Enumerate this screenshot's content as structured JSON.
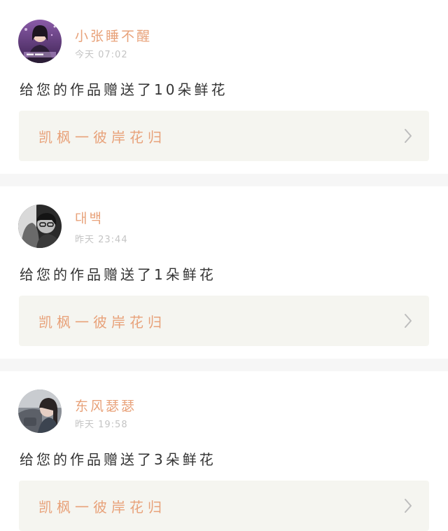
{
  "notifications": [
    {
      "username": "小张睡不醒",
      "time": "今天 07:02",
      "message": "给您的作品赠送了10朵鲜花",
      "work_title": "凯枫一彼岸花归",
      "avatar_icon": "user-avatar-purple-portrait"
    },
    {
      "username": "대백",
      "time": "昨天 23:44",
      "message": "给您的作品赠送了1朵鲜花",
      "work_title": "凯枫一彼岸花归",
      "avatar_icon": "user-avatar-grayscale-portrait"
    },
    {
      "username": "东风瑟瑟",
      "time": "昨天 19:58",
      "message": "给您的作品赠送了3朵鲜花",
      "work_title": "凯枫一彼岸花归",
      "avatar_icon": "user-avatar-car-portrait"
    }
  ],
  "colors": {
    "accent": "#e8a27a",
    "link_background": "#f5f5f0",
    "separator": "#f6f6f6",
    "timestamp": "#c4c4c4",
    "text": "#333333"
  },
  "icons": {
    "chevron": "chevron-right-icon"
  }
}
